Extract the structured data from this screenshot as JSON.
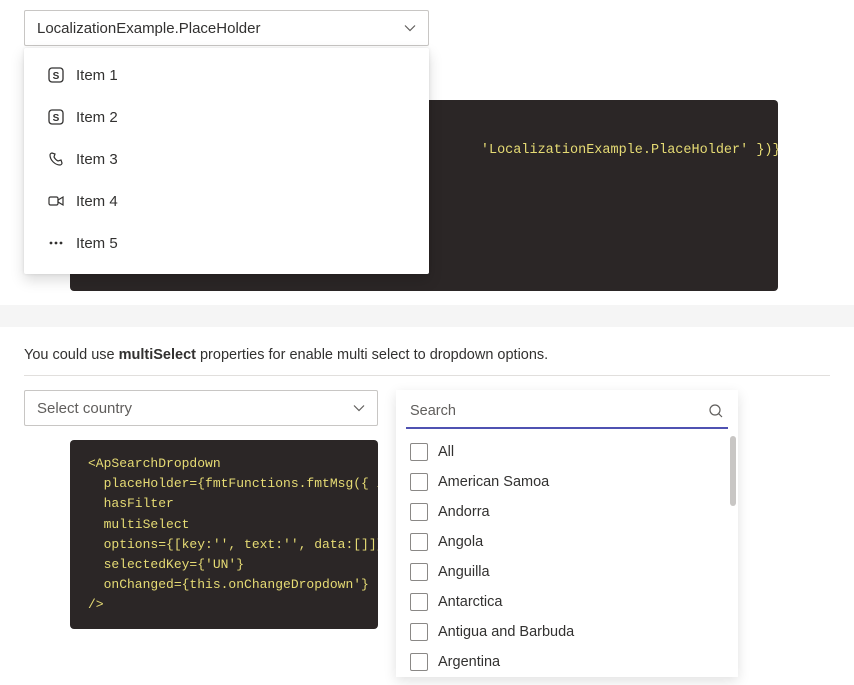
{
  "section1": {
    "placeholder": "LocalizationExample.PlaceHolder",
    "items": [
      {
        "label": "Item 1",
        "icon": "s-box"
      },
      {
        "label": "Item 2",
        "icon": "s-box"
      },
      {
        "label": "Item 3",
        "icon": "phone"
      },
      {
        "label": "Item 4",
        "icon": "video"
      },
      {
        "label": "Item 5",
        "icon": "dots"
      }
    ],
    "code_visible": "'LocalizationExample.PlaceHolder' })}",
    "code_closing": "/>"
  },
  "section2": {
    "desc_pre": "You could use ",
    "desc_strong": "multiSelect",
    "desc_post": " properties for enable multi select to dropdown options.",
    "select_placeholder": "Select country",
    "code": "<ApSearchDropdown\n  placeHolder={fmtFunctions.fmtMsg({ id:\n  hasFilter\n  multiSelect\n  options={[key:'', text:'', data:[]]}\n  selectedKey={'UN'}\n  onChanged={this.onChangeDropdown'}\n/>",
    "search_placeholder": "Search",
    "options": [
      "All",
      "American Samoa",
      "Andorra",
      "Angola",
      "Anguilla",
      "Antarctica",
      "Antigua and Barbuda",
      "Argentina"
    ]
  }
}
